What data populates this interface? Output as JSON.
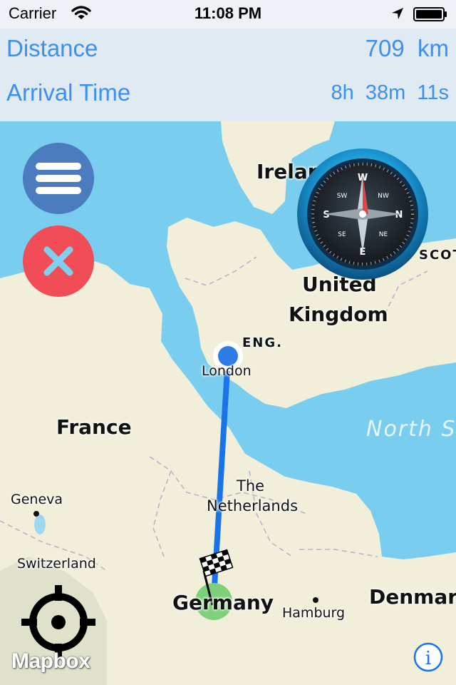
{
  "status_bar": {
    "carrier": "Carrier",
    "time": "11:08 PM"
  },
  "info": {
    "distance_label": "Distance",
    "distance_value": "709  km",
    "arrival_label": "Arrival  Time",
    "arrival_value": "8h  38m  11s"
  },
  "map": {
    "countries": [
      "Ireland",
      "United",
      "Kingdom",
      "France",
      "The",
      "Netherlands",
      "Germany",
      "Denmark"
    ],
    "regions": [
      "ENG.",
      "SCOT"
    ],
    "cities": [
      "London",
      "Geneva",
      "Switzerland",
      "Hamburg"
    ],
    "sea": "North S",
    "route_color": "#1a73e8",
    "origin_color": "#2c7de8",
    "destination_color": "#7ed07a",
    "attribution": "Mapbox"
  },
  "icons": {
    "menu": "hamburger-menu-icon",
    "close": "close-x-icon",
    "compass": "compass-icon",
    "locate": "crosshair-locate-icon",
    "finish": "checkered-flag-icon",
    "info": "info-icon"
  },
  "colors": {
    "accent": "#3d8ff0",
    "menu_button": "#4a7cbf",
    "close_button": "#f14d56",
    "water": "#79cdee",
    "land": "#f1efd9"
  }
}
